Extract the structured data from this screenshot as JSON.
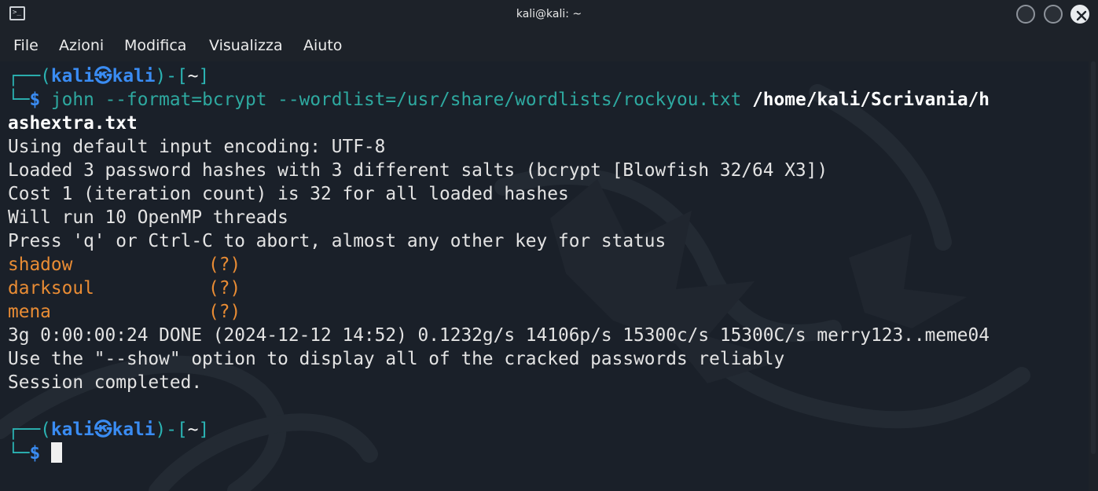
{
  "window": {
    "title": "kali@kali: ~",
    "icon": "terminal-icon"
  },
  "menu": {
    "file": "File",
    "azioni": "Azioni",
    "modifica": "Modifica",
    "visualizza": "Visualizza",
    "aiuto": "Aiuto"
  },
  "prompt1": {
    "corner_top": "┌──(",
    "user": "kali",
    "at_symbol": "㉿",
    "host": "kali",
    "sep": ")-[",
    "dir": "~",
    "close": "]",
    "corner_bottom": "└─",
    "dollar": "$",
    "cmd": "john",
    "args": "--format=bcrypt --wordlist=/usr/share/wordlists/rockyou.txt",
    "path_part1": "/home/kali/Scrivania/h",
    "path_part2": "ashextra.txt"
  },
  "output": {
    "l1": "Using default input encoding: UTF-8",
    "l2": "Loaded 3 password hashes with 3 different salts (bcrypt [Blowfish 32/64 X3])",
    "l3": "Cost 1 (iteration count) is 32 for all loaded hashes",
    "l4": "Will run 10 OpenMP threads",
    "l5": "Press 'q' or Ctrl-C to abort, almost any other key for status",
    "cracked": [
      {
        "password": "shadow",
        "user": "(?)"
      },
      {
        "password": "darksoul",
        "user": "(?)"
      },
      {
        "password": "mena",
        "user": "(?)"
      }
    ],
    "status": "3g 0:00:00:24 DONE (2024-12-12 14:52) 0.1232g/s 14106p/s 15300c/s 15300C/s merry123..meme04",
    "l_show": "Use the \"--show\" option to display all of the cracked passwords reliably",
    "l_done": "Session completed."
  },
  "prompt2": {
    "corner_top": "┌──(",
    "user": "kali",
    "at_symbol": "㉿",
    "host": "kali",
    "sep": ")-[",
    "dir": "~",
    "close": "]",
    "corner_bottom": "└─",
    "dollar": "$"
  }
}
